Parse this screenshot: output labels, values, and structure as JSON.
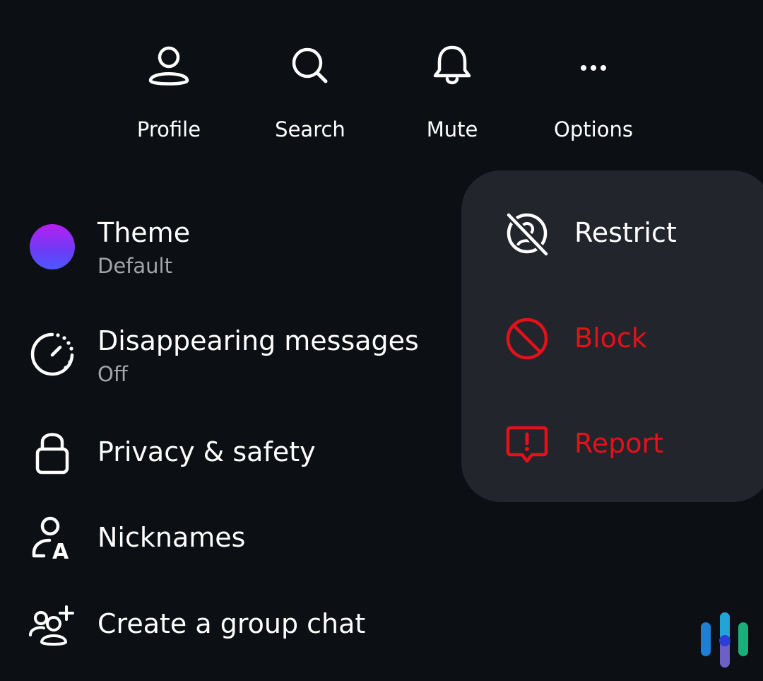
{
  "top_actions": [
    {
      "label": "Profile",
      "icon": "profile-icon"
    },
    {
      "label": "Search",
      "icon": "search-icon"
    },
    {
      "label": "Mute",
      "icon": "bell-icon"
    },
    {
      "label": "Options",
      "icon": "more-dots-icon"
    }
  ],
  "settings": {
    "theme": {
      "title": "Theme",
      "subtitle": "Default",
      "icon": "theme-swatch"
    },
    "disappearing": {
      "title": "Disappearing messages",
      "subtitle": "Off",
      "icon": "timer-icon"
    },
    "privacy": {
      "title": "Privacy & safety",
      "icon": "lock-icon"
    },
    "nicknames": {
      "title": "Nicknames",
      "icon": "nickname-icon"
    },
    "group_chat": {
      "title": "Create a group chat",
      "icon": "group-add-icon"
    }
  },
  "options_menu": {
    "items": [
      {
        "label": "Restrict",
        "icon": "restrict-icon",
        "color": "#ffffff"
      },
      {
        "label": "Block",
        "icon": "block-icon",
        "color": "#e5101a"
      },
      {
        "label": "Report",
        "icon": "report-icon",
        "color": "#e5101a"
      }
    ]
  },
  "colors": {
    "background": "#0c0f14",
    "menu_background": "#23252c",
    "danger": "#e5101a",
    "subtitle": "#a3a6ab"
  }
}
